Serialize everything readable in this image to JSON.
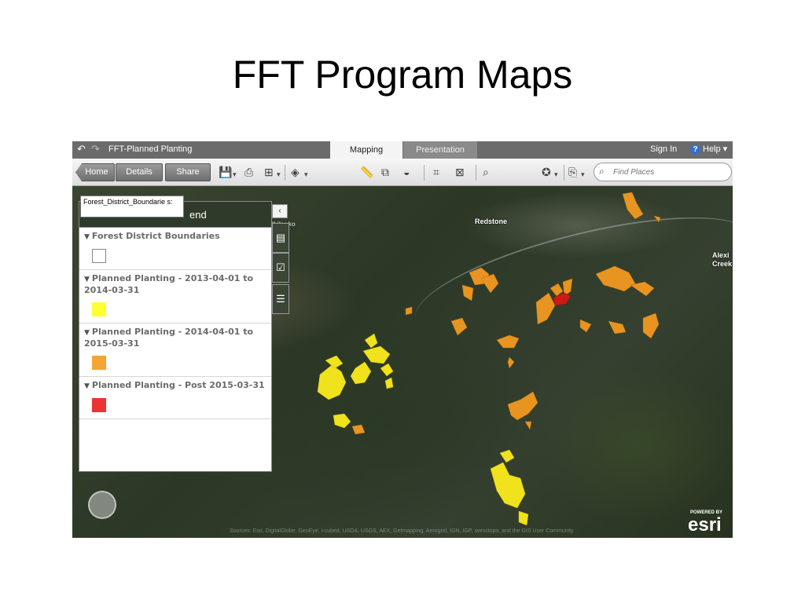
{
  "slide_title": "FFT Program Maps",
  "app": {
    "map_title": "FFT-Planned Planting",
    "tabs": [
      {
        "label": "Mapping"
      },
      {
        "label": "Presentation"
      }
    ],
    "sign_in": "Sign In",
    "help": "Help",
    "help_icon": "?",
    "toolbar": {
      "home": "Home",
      "details": "Details",
      "share": "Share",
      "search_placeholder": "Find Places"
    }
  },
  "map": {
    "places": [
      "Redstone",
      "Alexi",
      "Creek",
      "Chilanko"
    ],
    "attribution": "Sources: Esri, DigitalGlobe, GeoEye, i-cubed, USDA, USGS, AEX, Getmapping, Aerogrid, IGN, IGP, swisstopo, and the GIS User Community",
    "esri_powered": "POWERED BY",
    "esri_logo": "esri"
  },
  "legend": {
    "tooltip": "Forest_District_Boundarie s:",
    "title": "end",
    "collapse_icon": "‹",
    "items": [
      {
        "label": "Forest District Boundaries",
        "color": "#ffffff"
      },
      {
        "label": "Planned Planting - 2013-04-01 to 2014-03-31",
        "color": "#ffff33"
      },
      {
        "label": "Planned Planting - 2014-04-01 to 2015-03-31",
        "color": "#f5a534"
      },
      {
        "label": "Planned Planting - Post 2015-03-31",
        "color": "#ee3333"
      }
    ]
  },
  "colors": {
    "planting_2013": "#f0e21c",
    "planting_2014": "#e89420",
    "planting_post_2015": "#cc1b12"
  }
}
